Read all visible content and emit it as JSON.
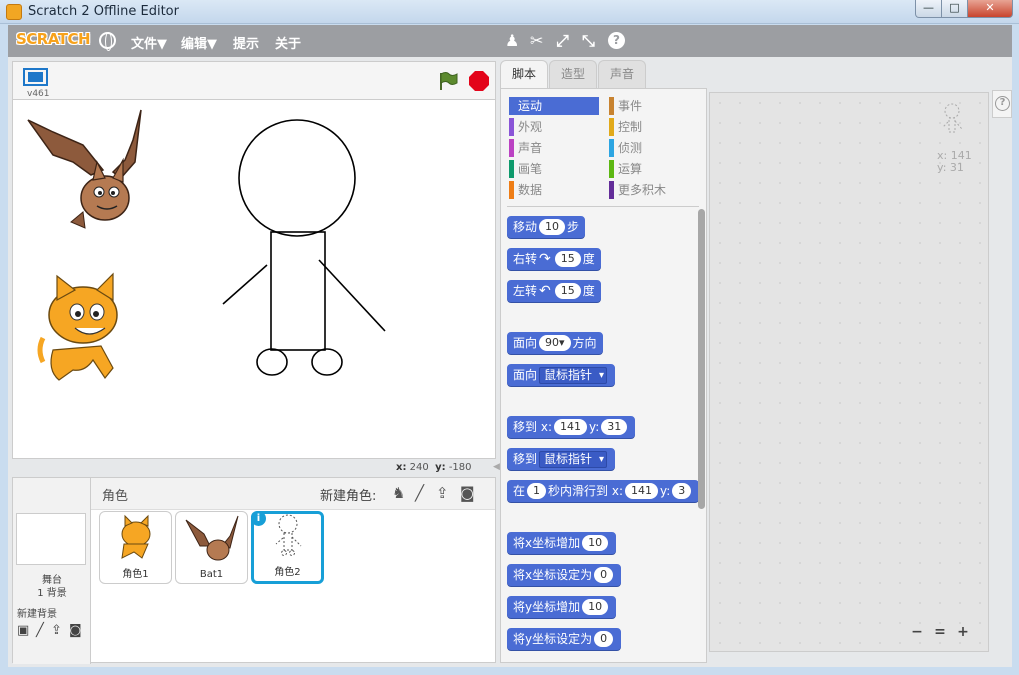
{
  "window": {
    "title": "Scratch 2 Offline Editor",
    "min": "—",
    "max": "□",
    "close": "✕"
  },
  "menu": {
    "logo": "SCRATCH",
    "file": "文件▼",
    "edit": "编辑▼",
    "tips": "提示",
    "about": "关于"
  },
  "stage": {
    "version": "v461",
    "mouse_x_label": "x:",
    "mouse_x": "240",
    "mouse_y_label": "y:",
    "mouse_y": "-180"
  },
  "sprites_pane": {
    "title": "角色",
    "new_sprite_label": "新建角色:",
    "stage_name": "舞台",
    "stage_backdrops": "1 背景",
    "new_backdrop_label": "新建背景",
    "sprites": [
      {
        "name": "角色1"
      },
      {
        "name": "Bat1"
      },
      {
        "name": "角色2",
        "selected": true
      }
    ],
    "info_icon": "i"
  },
  "tabs": [
    "脚本",
    "造型",
    "声音"
  ],
  "categories": [
    {
      "label": "运动",
      "color": "#4a6cd4",
      "active": true
    },
    {
      "label": "事件",
      "color": "#c88330"
    },
    {
      "label": "外观",
      "color": "#8a55d7"
    },
    {
      "label": "控制",
      "color": "#e1a91a"
    },
    {
      "label": "声音",
      "color": "#bb42c3"
    },
    {
      "label": "侦测",
      "color": "#2ca5e2"
    },
    {
      "label": "画笔",
      "color": "#0e9a6c"
    },
    {
      "label": "运算",
      "color": "#5cb712"
    },
    {
      "label": "数据",
      "color": "#ee7d16"
    },
    {
      "label": "更多积木",
      "color": "#632d99"
    }
  ],
  "blocks": {
    "move": {
      "pre": "移动",
      "value": "10",
      "post": "步"
    },
    "turn_right": {
      "pre": "右转",
      "icon": "↷",
      "value": "15",
      "post": "度"
    },
    "turn_left": {
      "pre": "左转",
      "icon": "↶",
      "value": "15",
      "post": "度"
    },
    "point_direction": {
      "pre": "面向",
      "value": "90▾",
      "post": "方向"
    },
    "point_towards": {
      "pre": "面向",
      "dropdown": "鼠标指针"
    },
    "go_to_xy": {
      "pre": "移到",
      "x_label": "x:",
      "x": "141",
      "y_label": "y:",
      "y": "31"
    },
    "go_to": {
      "pre": "移到",
      "dropdown": "鼠标指针"
    },
    "glide": {
      "pre": "在",
      "secs": "1",
      "mid": "秒内滑行到",
      "x_label": "x:",
      "x": "141",
      "y_label": "y:",
      "y": "3"
    },
    "change_x": {
      "pre": "将x坐标增加",
      "value": "10"
    },
    "set_x": {
      "pre": "将x坐标设定为",
      "value": "0"
    },
    "change_y": {
      "pre": "将y坐标增加",
      "value": "10"
    },
    "set_y": {
      "pre": "将y坐标设定为",
      "value": "0"
    }
  },
  "script_area": {
    "x_label": "x:",
    "x": "141",
    "y_label": "y:",
    "y": "31",
    "zoom_out": "−",
    "zoom_reset": "=",
    "zoom_in": "+"
  },
  "help": "?"
}
